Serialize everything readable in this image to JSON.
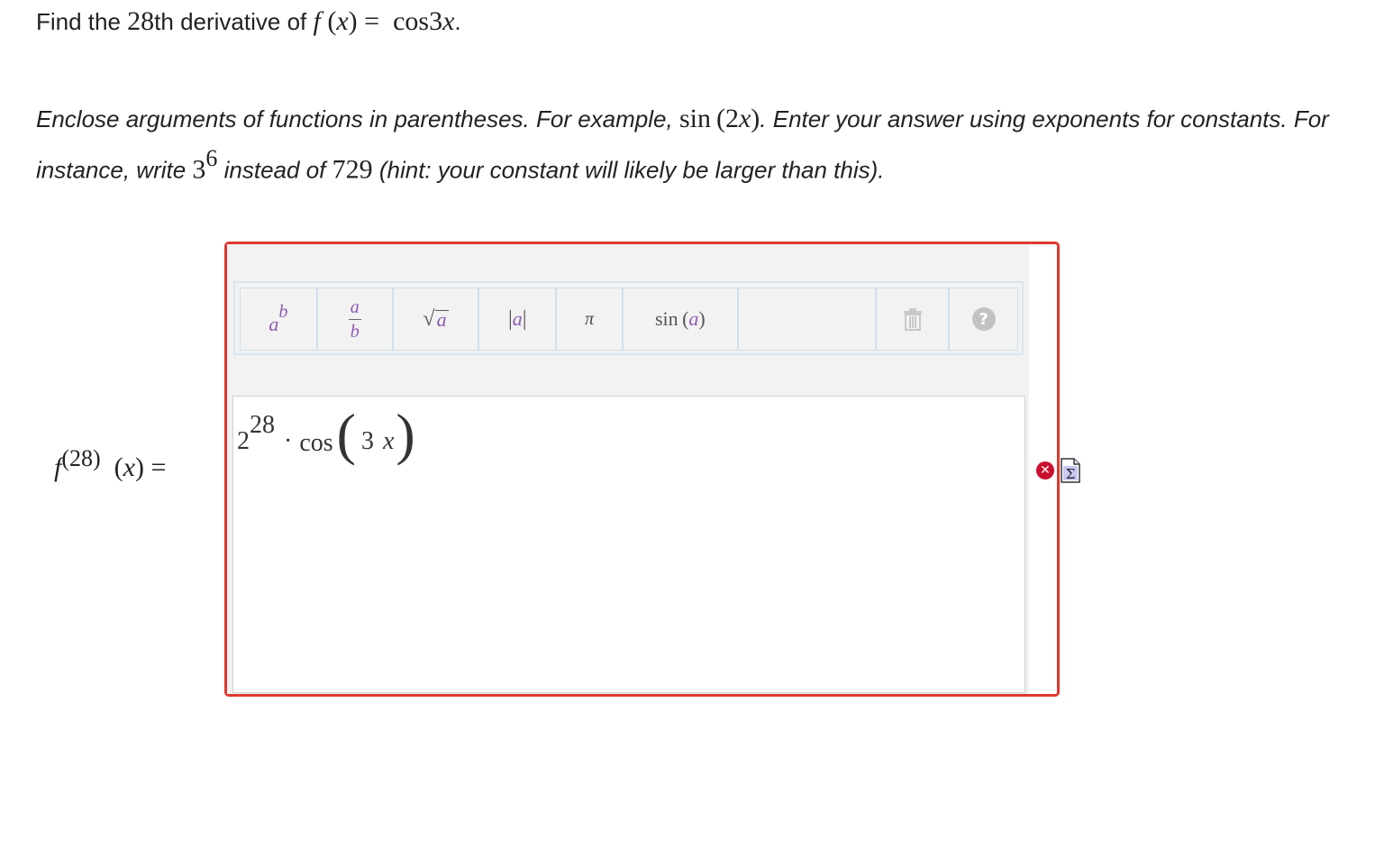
{
  "question": {
    "prefix": "Find the ",
    "ordinal": "28",
    "middle": "th derivative of ",
    "func": "f",
    "var": "x",
    "equals": "=",
    "rhs_fn": "cos",
    "rhs_coef": "3",
    "rhs_var": "x",
    "end": "."
  },
  "instructions": {
    "part1": "Enclose arguments of functions in parentheses. For example, ",
    "example_fn": "sin",
    "example_arg": "(2",
    "example_var": "x",
    "example_close": ")",
    "part2": ". Enter your answer using exponents for constants. For instance, write ",
    "base": "3",
    "exp": "6",
    "part3": " instead of ",
    "value": "729",
    "part4": " (hint: your constant will likely be larger than this)."
  },
  "answer_label": {
    "func": "f",
    "order": "(28)",
    "arg_open": "(",
    "var": "x",
    "arg_close": ")",
    "equals": "="
  },
  "toolbar": {
    "power_base": "a",
    "power_exp": "b",
    "frac_num": "a",
    "frac_den": "b",
    "sqrt_arg": "a",
    "abs_arg": "a",
    "pi": "π",
    "sin_fn": "sin",
    "sin_arg": "a",
    "help": "?"
  },
  "answer_input": {
    "base": "2",
    "exponent": "28",
    "dot": "·",
    "fn": "cos",
    "coef": "3",
    "var": "x"
  },
  "status": {
    "error_symbol": "✕",
    "error_color": "#c8102e",
    "frame_color": "#e0382e",
    "equation_editor_icon": "sigma-document-icon"
  }
}
